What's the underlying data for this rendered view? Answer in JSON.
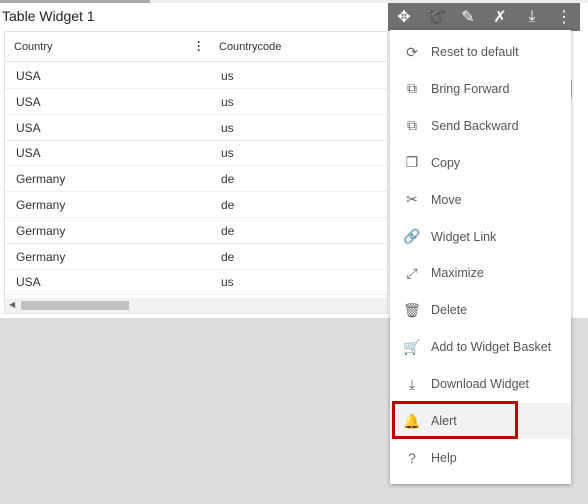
{
  "widget": {
    "title": "Table Widget 1"
  },
  "table": {
    "columns": [
      "Country",
      "Countrycode"
    ],
    "rows": [
      [
        "USA",
        "us"
      ],
      [
        "USA",
        "us"
      ],
      [
        "USA",
        "us"
      ],
      [
        "USA",
        "us"
      ],
      [
        "Germany",
        "de"
      ],
      [
        "Germany",
        "de"
      ],
      [
        "Germany",
        "de"
      ],
      [
        "Germany",
        "de"
      ],
      [
        "USA",
        "us"
      ]
    ]
  },
  "toolbar": {
    "icons": [
      "move-arrows-icon",
      "link-icon",
      "edit-icon",
      "tools-icon",
      "download-icon",
      "more-vertical-icon"
    ]
  },
  "menu": {
    "items": [
      {
        "label": "Reset to default",
        "icon": "refresh-icon",
        "glyph": "⟳"
      },
      {
        "label": "Bring Forward",
        "icon": "bring-forward-icon",
        "glyph": "⧉"
      },
      {
        "label": "Send Backward",
        "icon": "send-backward-icon",
        "glyph": "⧉"
      },
      {
        "label": "Copy",
        "icon": "copy-icon",
        "glyph": "❐"
      },
      {
        "label": "Move",
        "icon": "scissors-icon",
        "glyph": "✂"
      },
      {
        "label": "Widget Link",
        "icon": "link-icon",
        "glyph": "🔗"
      },
      {
        "label": "Maximize",
        "icon": "maximize-icon",
        "glyph": "⤢"
      },
      {
        "label": "Delete",
        "icon": "trash-icon",
        "glyph": "🗑"
      },
      {
        "label": "Add to Widget Basket",
        "icon": "cart-icon",
        "glyph": "🛒"
      },
      {
        "label": "Download Widget",
        "icon": "download-icon",
        "glyph": "⤓"
      },
      {
        "label": "Alert",
        "icon": "bell-icon",
        "glyph": "🔔"
      },
      {
        "label": "Help",
        "icon": "help-icon",
        "glyph": "?"
      }
    ],
    "highlighted": "Alert",
    "highlight_color": "#c00000"
  }
}
